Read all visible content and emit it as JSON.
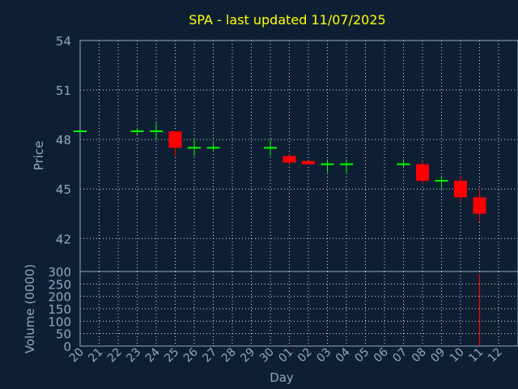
{
  "chart_data": {
    "type": "candlestick",
    "title": "SPA - last updated 11/07/2025",
    "price_panel": {
      "ylabel": "Price",
      "ylim": [
        40,
        54
      ],
      "yticks": [
        42,
        45,
        48,
        51,
        54
      ],
      "grid": true
    },
    "volume_panel": {
      "ylabel": "Volume (0000)",
      "ylim": [
        0,
        300
      ],
      "yticks": [
        0,
        50,
        100,
        150,
        200,
        250,
        300
      ],
      "grid": true
    },
    "xlabel": "Day",
    "x_tick_labels": [
      "20",
      "21",
      "22",
      "23",
      "24",
      "25",
      "26",
      "27",
      "28",
      "29",
      "30",
      "01",
      "02",
      "03",
      "04",
      "05",
      "06",
      "07",
      "08",
      "09",
      "10",
      "11",
      "12"
    ],
    "candles": [
      {
        "day": "20",
        "open": 48.5,
        "high": 48.5,
        "low": 48.5,
        "close": 48.5,
        "volume": 0
      },
      {
        "day": "23",
        "open": 48.5,
        "high": 48.7,
        "low": 48.3,
        "close": 48.5,
        "volume": 0
      },
      {
        "day": "24",
        "open": 48.5,
        "high": 49.0,
        "low": 48.0,
        "close": 48.5,
        "volume": 0
      },
      {
        "day": "25",
        "open": 48.5,
        "high": 48.5,
        "low": 47.0,
        "close": 47.5,
        "volume": 2
      },
      {
        "day": "26",
        "open": 47.5,
        "high": 48.0,
        "low": 47.0,
        "close": 47.5,
        "volume": 1
      },
      {
        "day": "27",
        "open": 47.5,
        "high": 47.8,
        "low": 47.3,
        "close": 47.5,
        "volume": 0
      },
      {
        "day": "30",
        "open": 47.5,
        "high": 48.0,
        "low": 47.0,
        "close": 47.5,
        "volume": 1
      },
      {
        "day": "01",
        "open": 47.0,
        "high": 47.1,
        "low": 46.5,
        "close": 46.6,
        "volume": 3
      },
      {
        "day": "02",
        "open": 46.7,
        "high": 46.7,
        "low": 46.5,
        "close": 46.5,
        "volume": 0
      },
      {
        "day": "03",
        "open": 46.5,
        "high": 46.8,
        "low": 46.0,
        "close": 46.5,
        "volume": 1
      },
      {
        "day": "04",
        "open": 46.5,
        "high": 46.8,
        "low": 46.0,
        "close": 46.5,
        "volume": 1
      },
      {
        "day": "07",
        "open": 46.5,
        "high": 46.8,
        "low": 46.3,
        "close": 46.5,
        "volume": 0
      },
      {
        "day": "08",
        "open": 46.5,
        "high": 46.7,
        "low": 45.3,
        "close": 45.5,
        "volume": 1
      },
      {
        "day": "09",
        "open": 45.5,
        "high": 45.8,
        "low": 45.0,
        "close": 45.5,
        "volume": 2
      },
      {
        "day": "10",
        "open": 45.5,
        "high": 45.8,
        "low": 44.2,
        "close": 44.5,
        "volume": 3
      },
      {
        "day": "11",
        "open": 44.5,
        "high": 45.0,
        "low": 43.0,
        "close": 43.5,
        "volume": 290
      }
    ],
    "colors": {
      "background": "#0f1f33",
      "up": "#00ff00",
      "down": "#ff0000",
      "title": "#ffff00",
      "axis_text": "#8fa8c8",
      "grid": "#ffffff"
    }
  }
}
